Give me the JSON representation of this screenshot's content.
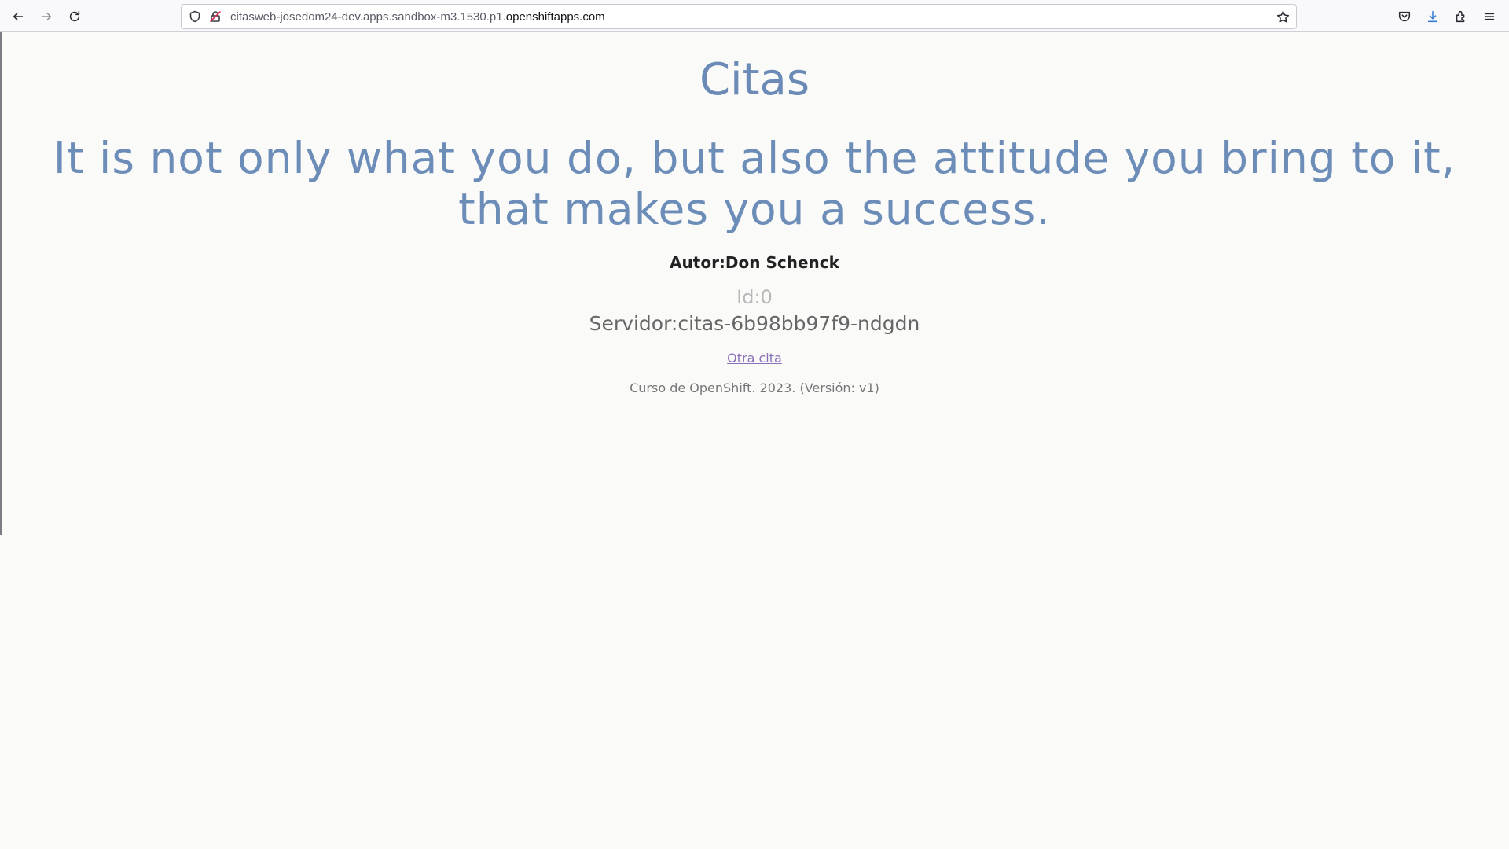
{
  "browser": {
    "url_prefix": "citasweb-josedom24-dev.apps.sandbox-m3.1530.p1.",
    "url_domain": "openshiftapps.com",
    "icons": [
      "back-arrow-icon",
      "forward-arrow-icon",
      "reload-icon",
      "shield-icon",
      "insecure-lock-icon",
      "star-icon",
      "pocket-icon",
      "download-icon",
      "extensions-icon",
      "menu-icon"
    ]
  },
  "page": {
    "title": "Citas",
    "quote": "It is not only what you do, but also the attitude you bring to it, that makes you a success.",
    "author": "Autor:Don Schenck",
    "id": "Id:0",
    "server": "Servidor:citas-6b98bb97f9-ndgdn",
    "link": "Otra cita",
    "footer": "Curso de OpenShift. 2023. (Versión: v1)"
  },
  "colors": {
    "heading": "#6b8bb6",
    "link": "#8a6fb8",
    "background": "#fafaf9"
  }
}
